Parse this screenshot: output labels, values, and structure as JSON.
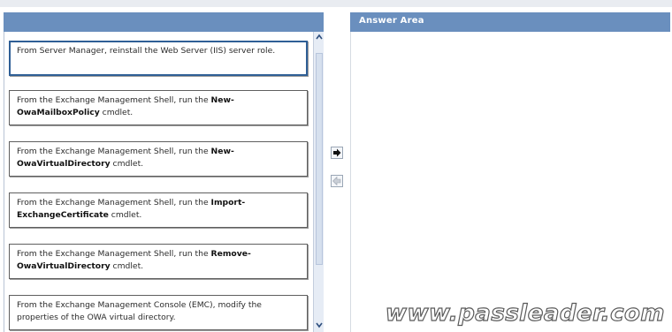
{
  "answer_area": {
    "title": "Answer Area"
  },
  "items": [
    {
      "pre": "From Server Manager, reinstall the Web Server (IIS) server role.",
      "bold": "",
      "post": ""
    },
    {
      "pre": "From the Exchange Management Shell, run the ",
      "bold": "New-OwaMailboxPolicy",
      "post": " cmdlet."
    },
    {
      "pre": "From the Exchange Management Shell, run the ",
      "bold": "New-OwaVirtualDirectory",
      "post": " cmdlet."
    },
    {
      "pre": "From the Exchange Management Shell, run the ",
      "bold": "Import-ExchangeCertificate",
      "post": " cmdlet."
    },
    {
      "pre": "From the Exchange Management Shell, run the ",
      "bold": "Remove-OwaVirtualDirectory",
      "post": " cmdlet."
    },
    {
      "pre": "From the Exchange Management Console (EMC), modify the properties of the OWA virtual directory.",
      "bold": "",
      "post": ""
    }
  ],
  "icons": {
    "move_right": "arrow-right-icon",
    "move_left": "arrow-left-icon",
    "scroll_up": "chevron-up-icon",
    "scroll_down": "chevron-down-icon"
  },
  "watermark": "www.passleader.com"
}
